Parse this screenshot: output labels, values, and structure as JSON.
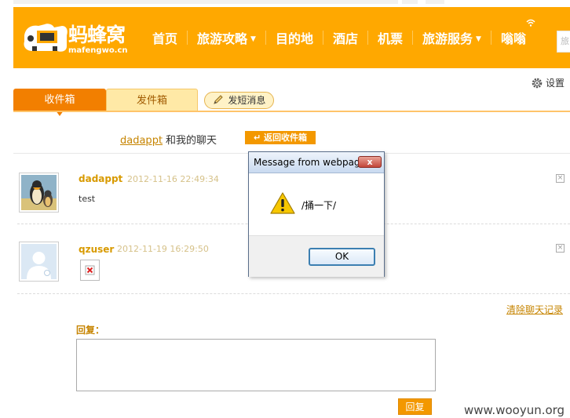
{
  "header": {
    "logo_text": "蚂蜂窝",
    "logo_domain": "mafengwo.cn",
    "nav": [
      {
        "label": "首页",
        "dropdown": false
      },
      {
        "label": "旅游攻略",
        "dropdown": true
      },
      {
        "label": "目的地",
        "dropdown": false
      },
      {
        "label": "酒店",
        "dropdown": false
      },
      {
        "label": "机票",
        "dropdown": false
      },
      {
        "label": "旅游服务",
        "dropdown": true
      },
      {
        "label": "嗡嗡",
        "dropdown": false
      }
    ],
    "search_placeholder": "旅"
  },
  "settings_label": "设置",
  "tabs": {
    "inbox": "收件箱",
    "outbox": "发件箱",
    "send_message": "发短消息"
  },
  "conversation": {
    "partner": "dadappt",
    "title_suffix": "和我的聊天",
    "back_button": "返回收件箱"
  },
  "messages": [
    {
      "user": "dadappt",
      "time": "2012-11-16 22:49:34",
      "text": "test"
    },
    {
      "user": "qzuser",
      "time": "2012-11-19 16:29:50",
      "text": ""
    }
  ],
  "clear_history": "清除聊天记录",
  "reply": {
    "label": "回复：",
    "value": "",
    "button": "回复"
  },
  "dialog": {
    "title": "Message from webpage",
    "close_glyph": "x",
    "message": "/捅一下/",
    "ok_label": "OK"
  },
  "watermark": "www.wooyun.org",
  "colors": {
    "brand_orange": "#ffa800",
    "tab_active": "#f27f00",
    "link": "#c68400"
  }
}
